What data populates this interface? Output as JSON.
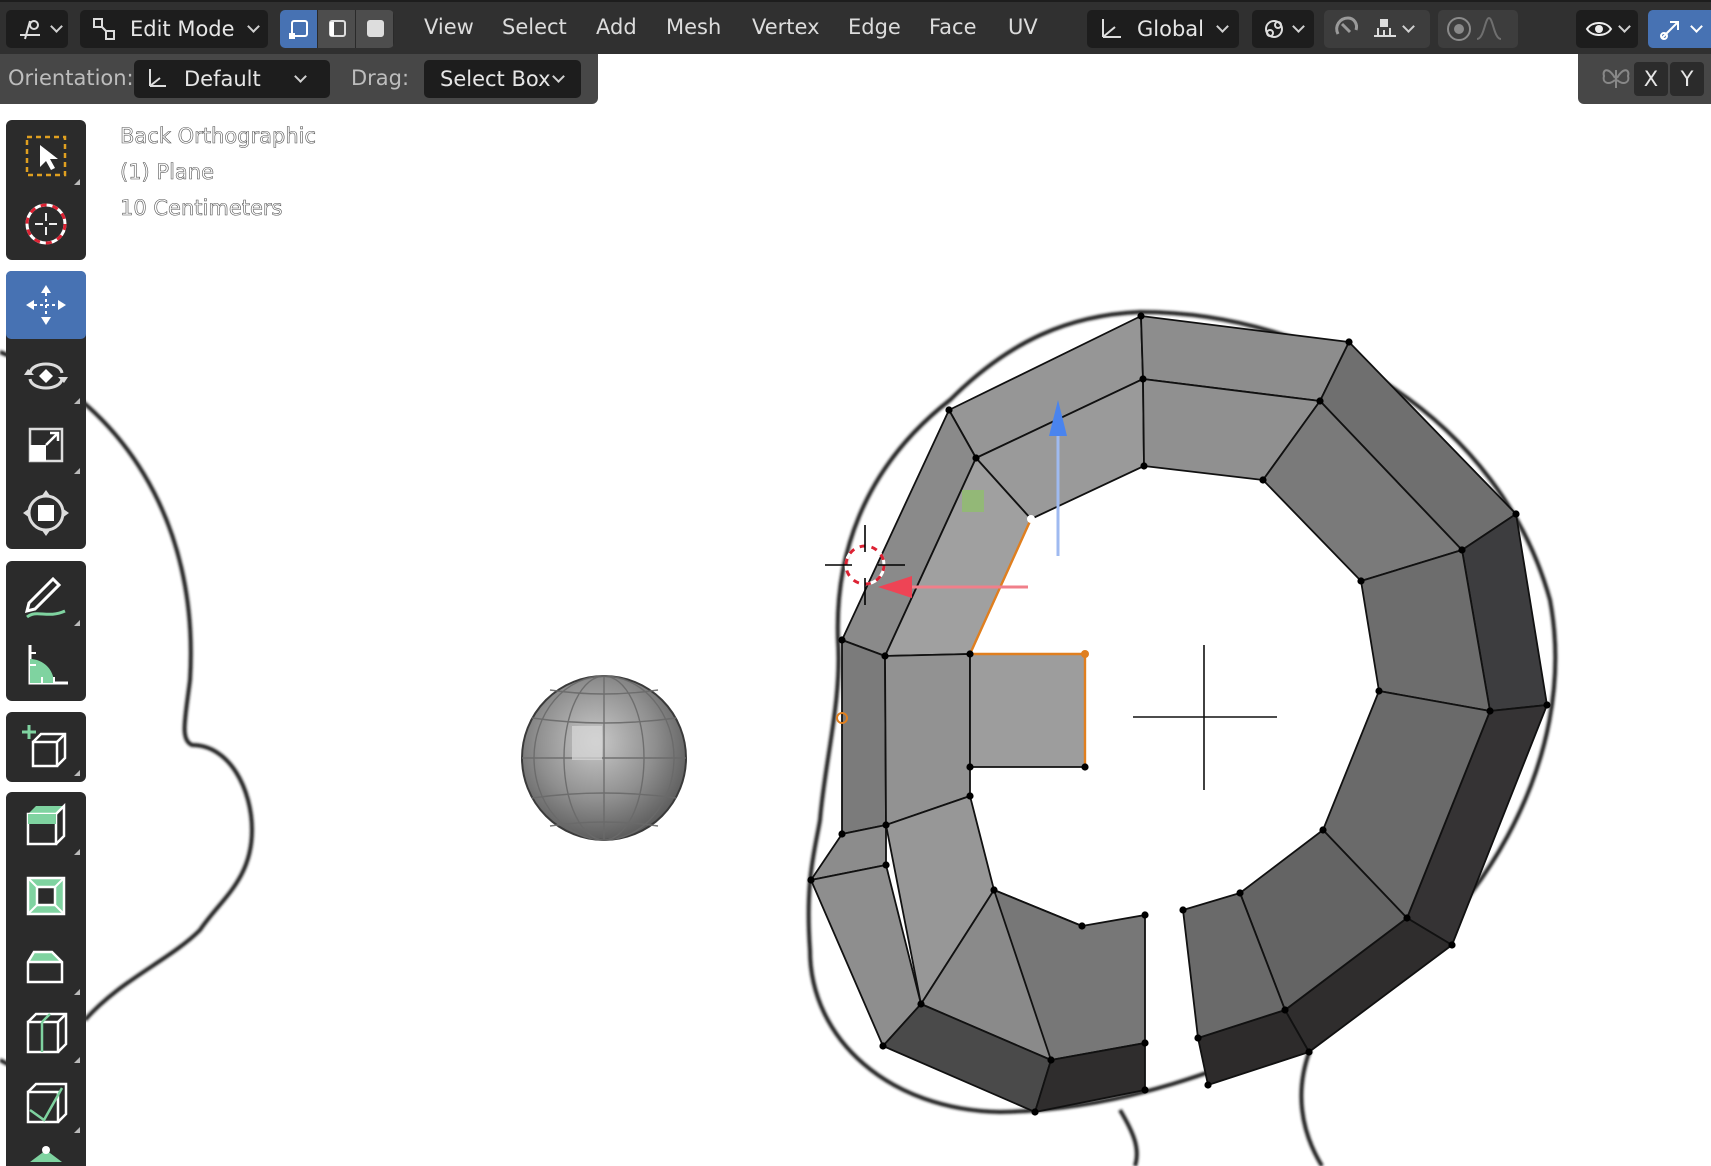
{
  "header": {
    "editor_type_icon": "object-mode-icon",
    "mode": "Edit Mode",
    "menus": [
      "View",
      "Select",
      "Add",
      "Mesh",
      "Vertex",
      "Edge",
      "Face",
      "UV"
    ],
    "transform_orientation": "Global"
  },
  "tool_settings": {
    "orientation_label": "Orientation:",
    "orientation_value": "Default",
    "drag_label": "Drag:",
    "drag_value": "Select Box",
    "axis_x": "X",
    "axis_y": "Y"
  },
  "overlay": {
    "view_name": "Back Orthographic",
    "object_name": "(1) Plane",
    "grid_scale": "10 Centimeters"
  },
  "toolbar": {
    "tools": [
      "select-box",
      "cursor",
      "move",
      "rotate",
      "scale",
      "transform",
      "annotate",
      "measure",
      "add-cube",
      "extrude-region",
      "inset-faces",
      "bevel",
      "loop-cut",
      "knife",
      "poly-build"
    ],
    "active_tool": "move"
  },
  "colors": {
    "header_bg": "#303030",
    "tool_settings_bg": "#474747",
    "active_blue": "#4772b3",
    "toolbar_bg": "#2b2b2b",
    "selected_orange": "#e07f1f",
    "gizmo_x": "#ee4455",
    "gizmo_z": "#4a84ee"
  }
}
